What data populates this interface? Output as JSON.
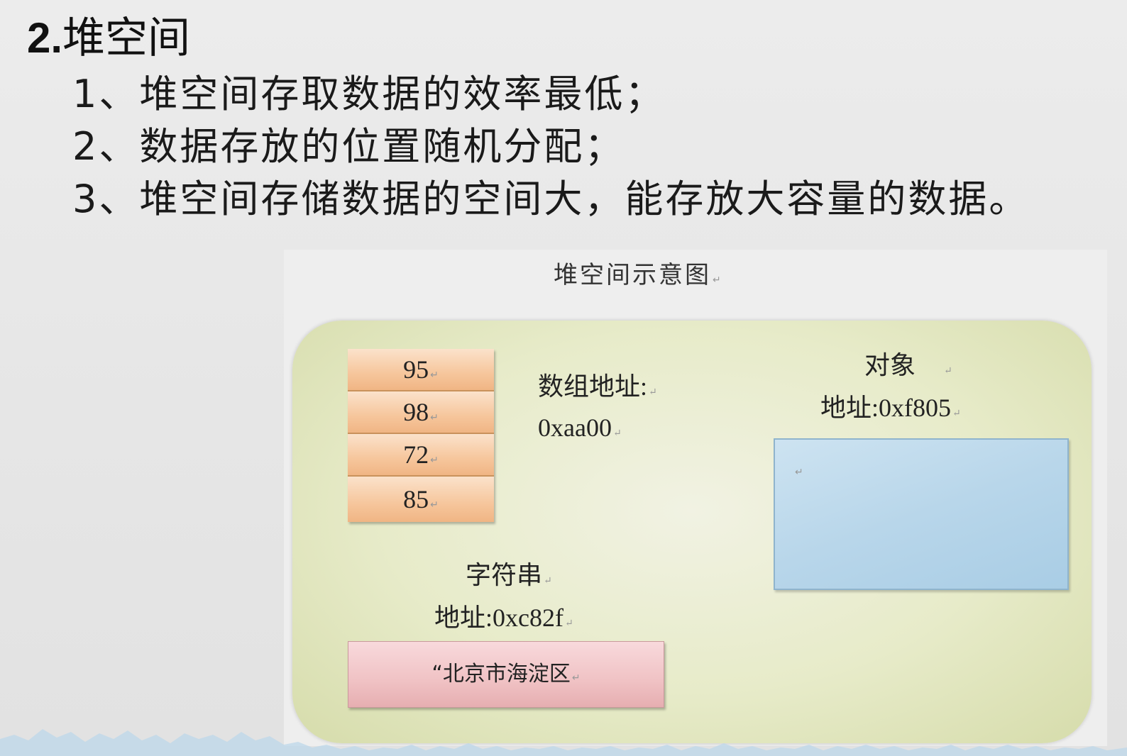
{
  "slide": {
    "title_number": "2.",
    "title_text": "堆空间",
    "points": [
      "1、堆空间存取数据的效率最低；",
      "2、数据存放的位置随机分配；",
      "3、堆空间存储数据的空间大，能存放大容量的数据。"
    ]
  },
  "figure": {
    "title": "堆空间示意图",
    "array": {
      "values": [
        "95",
        "98",
        "72",
        "85"
      ],
      "label_line1": "数组地址:",
      "label_line2": "0xaa00"
    },
    "object": {
      "label_line1": "对象",
      "label_line2": "地址:0xf805"
    },
    "string": {
      "label_line1": "字符串",
      "label_line2": "地址:0xc82f",
      "value": "“北京市海淀区"
    },
    "paragraph_mark": "↵"
  },
  "colors": {
    "array_cell": "#f6c69c",
    "object_box": "#b8d6ea",
    "string_box": "#f0c2c4",
    "heap_area": "#e7ebc9"
  }
}
